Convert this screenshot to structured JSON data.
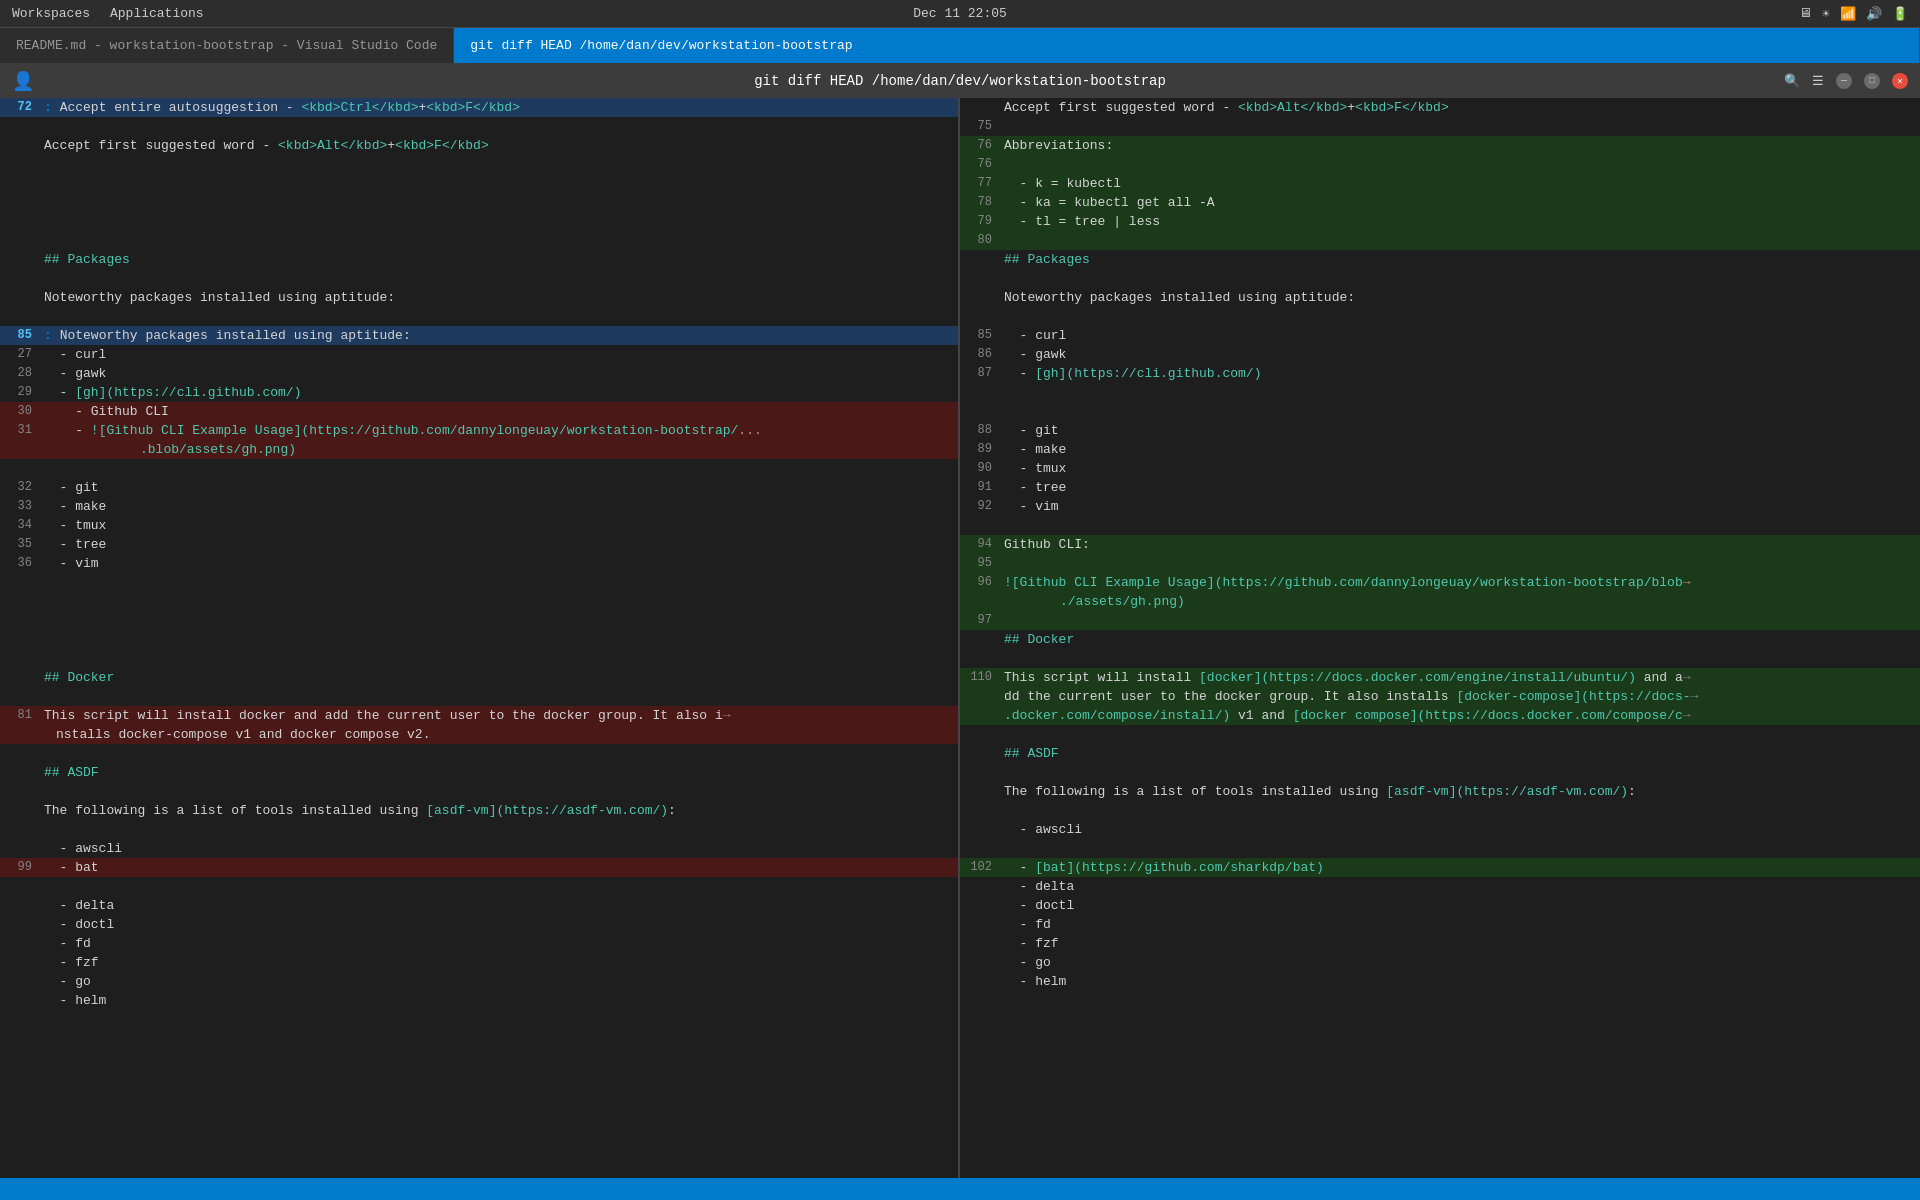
{
  "os_bar": {
    "left": [
      "Workspaces",
      "Applications"
    ],
    "center": "Dec 11  22:05",
    "right": [
      "🖥",
      "☀",
      "📶",
      "🔊",
      "🔋"
    ]
  },
  "tab_bar": {
    "tabs": [
      {
        "id": "readme-tab",
        "label": "README.md - workstation-bootstrap - Visual Studio Code",
        "active": false
      },
      {
        "id": "terminal-tab",
        "label": "git diff HEAD /home/dan/dev/workstation-bootstrap",
        "active": true
      }
    ]
  },
  "title_bar": {
    "icon": "👤",
    "title": "git diff HEAD /home/dan/dev/workstation-bootstrap",
    "search_icon": "🔍",
    "menu_icon": "☰",
    "min_icon": "—",
    "close_icon": "✕"
  },
  "status_bar": {
    "text": ""
  },
  "left_panel": {
    "lines": [
      {
        "num": "",
        "content": "",
        "type": "goto",
        "goto_num": "72",
        "goto_text": "Accept entire autosuggestion - <kbd>Ctrl</kbd>+<kbd>F</kbd></kbd>"
      },
      {
        "num": "",
        "content": "",
        "type": "normal"
      },
      {
        "num": "",
        "content": "Accept first suggested word - <kbd>Alt</kbd>+<kbd>F</kbd>",
        "type": "normal",
        "has_code": true
      },
      {
        "num": "",
        "content": "",
        "type": "normal"
      },
      {
        "num": "",
        "content": "",
        "type": "normal"
      },
      {
        "num": "",
        "content": "",
        "type": "normal"
      },
      {
        "num": "",
        "content": "",
        "type": "normal"
      },
      {
        "num": "",
        "content": "",
        "type": "normal"
      },
      {
        "num": "",
        "content": "## Packages",
        "type": "normal",
        "heading": true
      },
      {
        "num": "",
        "content": "",
        "type": "normal"
      },
      {
        "num": "",
        "content": "Noteworthy packages installed using aptitude:",
        "type": "normal"
      },
      {
        "num": "",
        "content": "",
        "type": "normal"
      },
      {
        "num": "",
        "content": "",
        "type": "goto",
        "goto_num": "85",
        "goto_text": "Noteworthy packages installed using aptitude:"
      },
      {
        "num": "27",
        "content": "  - curl",
        "type": "normal"
      },
      {
        "num": "28",
        "content": "  - gawk",
        "type": "normal"
      },
      {
        "num": "29",
        "content": "  - [gh](https://cli.github.com/)",
        "type": "normal",
        "link": true
      },
      {
        "num": "30",
        "content": "    - Github CLI",
        "type": "removed"
      },
      {
        "num": "31",
        "content": "    - ![Github CLI Example Usage](https://github.com/dannylongeuay/workstation-bootstrap/...blob/assets/gh.png)",
        "type": "removed",
        "link2": true
      },
      {
        "num": "",
        "content": "",
        "type": "normal"
      },
      {
        "num": "32",
        "content": "  - git",
        "type": "normal"
      },
      {
        "num": "33",
        "content": "  - make",
        "type": "normal"
      },
      {
        "num": "34",
        "content": "  - tmux",
        "type": "normal"
      },
      {
        "num": "35",
        "content": "  - tree",
        "type": "normal"
      },
      {
        "num": "36",
        "content": "  - vim",
        "type": "normal"
      },
      {
        "num": "",
        "content": "",
        "type": "normal"
      },
      {
        "num": "",
        "content": "",
        "type": "normal"
      },
      {
        "num": "",
        "content": "",
        "type": "normal"
      },
      {
        "num": "",
        "content": "",
        "type": "normal"
      },
      {
        "num": "",
        "content": "",
        "type": "normal"
      },
      {
        "num": "",
        "content": "## Docker",
        "type": "normal",
        "heading": true
      },
      {
        "num": "",
        "content": "",
        "type": "normal"
      },
      {
        "num": "81",
        "content": "This script will install docker and add the current user to the docker group. It also installs docker-compose v1 and docker compose v2.",
        "type": "removed",
        "wrap": true
      },
      {
        "num": "",
        "content": "",
        "type": "normal"
      },
      {
        "num": "",
        "content": "## ASDF",
        "type": "normal",
        "heading": true
      },
      {
        "num": "",
        "content": "",
        "type": "normal"
      },
      {
        "num": "",
        "content": "The following is a list of tools installed using [asdf-vm](https://asdf-vm.com/):",
        "type": "normal",
        "link": true
      },
      {
        "num": "",
        "content": "",
        "type": "normal"
      },
      {
        "num": "",
        "content": "  - awscli",
        "type": "normal"
      },
      {
        "num": "99",
        "content": "  - bat",
        "type": "removed"
      },
      {
        "num": "",
        "content": "",
        "type": "normal"
      },
      {
        "num": "",
        "content": "  - delta",
        "type": "normal"
      },
      {
        "num": "",
        "content": "  - doctl",
        "type": "normal"
      },
      {
        "num": "",
        "content": "  - fd",
        "type": "normal"
      },
      {
        "num": "",
        "content": "  - fzf",
        "type": "normal"
      },
      {
        "num": "",
        "content": "  - go",
        "type": "normal"
      },
      {
        "num": "",
        "content": "  - helm",
        "type": "normal"
      }
    ]
  },
  "right_panel": {
    "lines": [
      {
        "num": "",
        "content": "Accept first suggested word - Alt+F (with kbd markup)",
        "type": "normal",
        "raw": "Accept first suggested word - <kbd>Alt</kbd>+<kbd>F</kbd>"
      },
      {
        "num": "75",
        "content": "",
        "type": "normal"
      },
      {
        "num": "76",
        "content": "Abbreviations:",
        "type": "added"
      },
      {
        "num": "76",
        "content": "",
        "type": "added"
      },
      {
        "num": "77",
        "content": "  - k = kubectl",
        "type": "added"
      },
      {
        "num": "78",
        "content": "  - ka = kubectl get all -A",
        "type": "added"
      },
      {
        "num": "79",
        "content": "  - tl = tree | less",
        "type": "added"
      },
      {
        "num": "80",
        "content": "",
        "type": "added"
      },
      {
        "num": "",
        "content": "## Packages",
        "type": "normal",
        "heading": true
      },
      {
        "num": "",
        "content": "",
        "type": "normal"
      },
      {
        "num": "",
        "content": "Noteworthy packages installed using aptitude:",
        "type": "normal"
      },
      {
        "num": "",
        "content": "",
        "type": "normal"
      },
      {
        "num": "85",
        "content": "  - curl",
        "type": "normal"
      },
      {
        "num": "86",
        "content": "  - gawk",
        "type": "normal"
      },
      {
        "num": "87",
        "content": "  - [gh](https://cli.github.com/)",
        "type": "normal",
        "link": true
      },
      {
        "num": "",
        "content": "",
        "type": "normal"
      },
      {
        "num": "",
        "content": "",
        "type": "normal"
      },
      {
        "num": "88",
        "content": "  - git",
        "type": "normal"
      },
      {
        "num": "89",
        "content": "  - make",
        "type": "normal"
      },
      {
        "num": "90",
        "content": "  - tmux",
        "type": "normal"
      },
      {
        "num": "91",
        "content": "  - tree",
        "type": "normal"
      },
      {
        "num": "92",
        "content": "  - vim",
        "type": "normal"
      },
      {
        "num": "",
        "content": "",
        "type": "normal"
      },
      {
        "num": "94",
        "content": "Github CLI:",
        "type": "added"
      },
      {
        "num": "95",
        "content": "",
        "type": "added"
      },
      {
        "num": "96",
        "content": "![Github CLI Example Usage](https://github.com/dannylongeuay/workstation-bootstrap/blob.../assets/gh.png)",
        "type": "added",
        "link": true
      },
      {
        "num": "97",
        "content": "",
        "type": "added"
      },
      {
        "num": "",
        "content": "## Docker",
        "type": "normal",
        "heading": true
      },
      {
        "num": "",
        "content": "",
        "type": "normal"
      },
      {
        "num": "110",
        "content": "This script will install [docker](https://docs.docker.com/engine/install/ubuntu/) and add the current user to the docker group. It also installs [docker-compose](https://docs.docker.com/compose/install/) v1 and [docker compose](https://docs.docker.com/compose/c...) ",
        "type": "added",
        "wrap": true
      },
      {
        "num": "",
        "content": "",
        "type": "normal"
      },
      {
        "num": "",
        "content": "## ASDF",
        "type": "normal",
        "heading": true
      },
      {
        "num": "",
        "content": "",
        "type": "normal"
      },
      {
        "num": "",
        "content": "The following is a list of tools installed using [asdf-vm](https://asdf-vm.com/):",
        "type": "normal",
        "link": true
      },
      {
        "num": "",
        "content": "",
        "type": "normal"
      },
      {
        "num": "",
        "content": "  - awscli",
        "type": "normal"
      },
      {
        "num": "",
        "content": "",
        "type": "normal"
      },
      {
        "num": "102",
        "content": "  - [bat](https://github.com/sharkdp/bat)",
        "type": "added",
        "link": true
      },
      {
        "num": "",
        "content": "  - delta",
        "type": "normal"
      },
      {
        "num": "",
        "content": "  - doctl",
        "type": "normal"
      },
      {
        "num": "",
        "content": "  - fd",
        "type": "normal"
      },
      {
        "num": "",
        "content": "  - fzf",
        "type": "normal"
      },
      {
        "num": "",
        "content": "  - go",
        "type": "normal"
      },
      {
        "num": "",
        "content": "  - helm",
        "type": "normal"
      }
    ]
  }
}
